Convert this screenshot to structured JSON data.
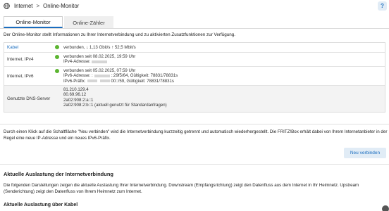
{
  "breadcrumb": {
    "parent": "Internet",
    "separator": ">",
    "current": "Online-Monitor"
  },
  "help_label": "?",
  "tabs": [
    {
      "label": "Online-Monitor",
      "active": true
    },
    {
      "label": "Online-Zähler",
      "active": false
    }
  ],
  "intro": "Der Online-Monitor stellt Informationen zu Ihrer Internetverbindung und zu aktivierten Zusatzfunktionen zur Verfügung.",
  "status": {
    "kabel": {
      "label": "Kabel",
      "line1": "verbunden, ↓ 1,13 Gbit/s ↑ 52,5 Mbit/s"
    },
    "ipv4": {
      "label": "Internet, IPv4",
      "line1": "verbunden seit 08.02.2025, 19:59 Uhr",
      "line2_prefix": "IPv4-Adresse:"
    },
    "ipv6": {
      "label": "Internet, IPv6",
      "line1": "verbunden seit 05.02.2025, 07:59 Uhr",
      "line2_prefix": "IPv6-Adresse: :",
      "line2_suffix": "::29f5/64, Gültigkeit: 78831/78831s",
      "line3_prefix": "IPv6-Präfix:",
      "line3_suffix": "00::/59, Gültigkeit: 78831/78831s"
    },
    "dns": {
      "label": "Genutzte DNS-Server",
      "lines": [
        "81.210.129.4",
        "80.69.96.12",
        "2a02:908:2:a::1",
        "2a02:908:2:b::1 (aktuell genutzt für Standardanfragen)"
      ]
    },
    "status_color": "#5cb531"
  },
  "reconnect": {
    "text": "Durch einen Klick auf die Schaltfläche \"Neu verbinden\" wird die Internetverbindung kurzzeitig getrennt und automatisch wiederhergestellt. Die FRITZ!Box erhält dabei von Ihrem Internetanbieter in der Regel eine neue IP-Adresse und ein neues IPv6-Präfix.",
    "button": "Neu verbinden"
  },
  "load": {
    "title": "Aktuelle Auslastung der Internetverbindung",
    "text": "Die folgenden Darstellungen zeigen die aktuelle Auslastung Ihrer Internetverbindung. Downstream (Empfangsrichtung) zeigt den Datenfluss aus dem Internet in Ihr Heimnetz. Upstream (Senderichtung) zeigt den Datenfluss von Ihrem Heimnetz zum Internet.",
    "subtitle": "Aktuelle Auslastung über Kabel"
  },
  "accent_color": "#1a6dbf"
}
